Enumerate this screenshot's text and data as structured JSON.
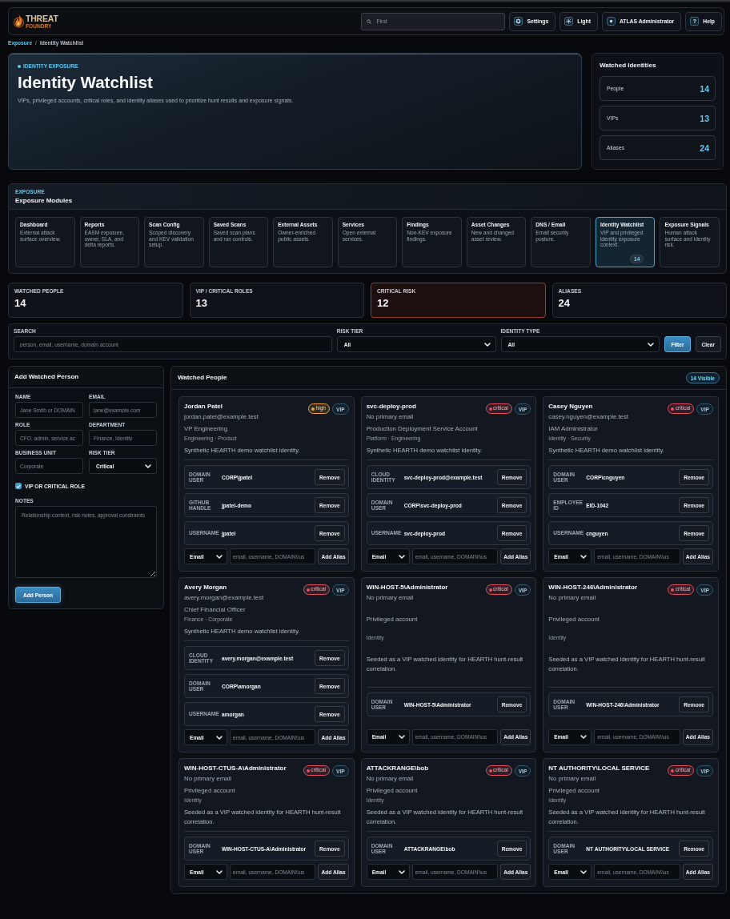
{
  "header": {
    "logo": {
      "wordmark": "THREAT",
      "subtitle": "FOUNDRY"
    },
    "search": {
      "placeholder": "Find"
    },
    "buttons": [
      {
        "kind": "gear",
        "label": "Settings"
      },
      {
        "kind": "sun",
        "label": "Light"
      },
      {
        "kind": "dot",
        "label": "ATLAS Administrator"
      },
      {
        "kind": "glyph",
        "glyph": "?",
        "label": "Help"
      }
    ]
  },
  "breadcrumb": {
    "separator": "/",
    "items": [
      {
        "label": "Exposure",
        "current": false
      },
      {
        "label": "Identity Watchlist",
        "current": true
      }
    ]
  },
  "hero": {
    "eyebrow": "IDENTITY EXPOSURE",
    "title": "Identity Watchlist",
    "description": "VIPs, privileged accounts, critical roles, and identity aliases used to prioritize hunt results and exposure signals."
  },
  "summary": {
    "title": "Watched Identities",
    "items": [
      {
        "label": "People",
        "value": "14"
      },
      {
        "label": "VIPs",
        "value": "13"
      },
      {
        "label": "Aliases",
        "value": "24"
      }
    ]
  },
  "modules": {
    "eyebrow": "EXPOSURE",
    "title": "Exposure Modules",
    "items": [
      {
        "name": "Dashboard",
        "description": "External attack surface overview.",
        "selected": false
      },
      {
        "name": "Reports",
        "description": "EASM exposure, owner, SLA, and delta reports.",
        "selected": false
      },
      {
        "name": "Scan Config",
        "description": "Scoped discovery and KEV validation setup.",
        "selected": false
      },
      {
        "name": "Saved Scans",
        "description": "Saved scan plans and run controls.",
        "selected": false
      },
      {
        "name": "External Assets",
        "description": "Owner-enriched public assets.",
        "selected": false
      },
      {
        "name": "Services",
        "description": "Open external services.",
        "selected": false
      },
      {
        "name": "Findings",
        "description": "Non-KEV exposure findings.",
        "selected": false
      },
      {
        "name": "Asset Changes",
        "description": "New and changed asset review.",
        "selected": false
      },
      {
        "name": "DNS / Email",
        "description": "Email security posture.",
        "selected": false
      },
      {
        "name": "Identity Watchlist",
        "description": "VIP and privileged identity exposure context.",
        "selected": true,
        "count": "14"
      },
      {
        "name": "Exposure Signals",
        "description": "Human attack surface and identity risk.",
        "selected": false
      }
    ]
  },
  "stats": [
    {
      "label": "WATCHED PEOPLE",
      "value": "14",
      "alert": false
    },
    {
      "label": "VIP / CRITICAL ROLES",
      "value": "13",
      "alert": false
    },
    {
      "label": "CRITICAL RISK",
      "value": "12",
      "alert": true
    },
    {
      "label": "ALIASES",
      "value": "24",
      "alert": false
    }
  ],
  "filters": {
    "fields": [
      {
        "kind": "input",
        "label": "SEARCH",
        "placeholder": "person, email, username, domain account"
      },
      {
        "kind": "select",
        "label": "RISK TIER",
        "value": "All"
      },
      {
        "kind": "select",
        "label": "IDENTITY TYPE",
        "value": "All"
      }
    ],
    "buttons": [
      {
        "label": "Filter",
        "primary": true
      },
      {
        "label": "Clear",
        "primary": false
      }
    ]
  },
  "add_form": {
    "title": "Add Watched Person",
    "fields": [
      {
        "kind": "input",
        "label": "NAME",
        "placeholder": "Jane Smith or DOMAIN"
      },
      {
        "kind": "input",
        "label": "EMAIL",
        "placeholder": "jane@example.com"
      },
      {
        "kind": "input",
        "label": "ROLE",
        "placeholder": "CFO, admin, service ac"
      },
      {
        "kind": "input",
        "label": "DEPARTMENT",
        "placeholder": "Finance, Identity"
      },
      {
        "kind": "input",
        "label": "BUSINESS UNIT",
        "placeholder": "Corporate"
      },
      {
        "kind": "select",
        "label": "RISK TIER",
        "value": "Critical"
      }
    ],
    "vip": {
      "label": "VIP OR CRITICAL ROLE",
      "checked": true
    },
    "notes": {
      "label": "NOTES",
      "placeholder": "Relationship context, risk notes, approval constraints"
    },
    "submit": "Add Person"
  },
  "people_panel": {
    "title": "Watched People",
    "badge": "14 Visible",
    "people": [
      {
        "name": "Jordan Patel",
        "email": "jordan.patel@example.test",
        "risk": {
          "label": "high",
          "color": "#f0a53a"
        },
        "tag": "VIP",
        "role": "VP Engineering",
        "org": "Engineering · Product",
        "note": "Synthetic HEARTH demo watchlist identity.",
        "aliases": [
          {
            "type": "DOMAIN USER",
            "value": "CORP\\jpatel",
            "action": "Remove"
          },
          {
            "type": "GITHUB HANDLE",
            "value": "jpatel-demo",
            "action": "Remove"
          },
          {
            "type": "USERNAME",
            "value": "jpatel",
            "action": "Remove"
          }
        ],
        "add_alias": {
          "type": "Email",
          "placeholder": "email, username, DOMAIN\\\\us",
          "button": "Add Alias"
        }
      },
      {
        "name": "svc-deploy-prod",
        "email": "No primary email",
        "risk": {
          "label": "critical",
          "color": "#e5505e"
        },
        "tag": "VIP",
        "role": "Production Deployment Service Account",
        "org": "Platform · Engineering",
        "note": "Synthetic HEARTH demo watchlist identity.",
        "aliases": [
          {
            "type": "CLOUD IDENTITY",
            "value": "svc-deploy-prod@example.test",
            "action": "Remove"
          },
          {
            "type": "DOMAIN USER",
            "value": "CORP\\svc-deploy-prod",
            "action": "Remove"
          },
          {
            "type": "USERNAME",
            "value": "svc-deploy-prod",
            "action": "Remove"
          }
        ],
        "add_alias": {
          "type": "Email",
          "placeholder": "email, username, DOMAIN\\\\us",
          "button": "Add Alias"
        }
      },
      {
        "name": "Casey Nguyen",
        "email": "casey.nguyen@example.test",
        "risk": {
          "label": "critical",
          "color": "#e5505e"
        },
        "tag": "VIP",
        "role": "IAM Administrator",
        "org": "Identity · Security",
        "note": "Synthetic HEARTH demo watchlist identity.",
        "aliases": [
          {
            "type": "DOMAIN USER",
            "value": "CORP\\cnguyen",
            "action": "Remove"
          },
          {
            "type": "EMPLOYEE ID",
            "value": "EID-1042",
            "action": "Remove"
          },
          {
            "type": "USERNAME",
            "value": "cnguyen",
            "action": "Remove"
          }
        ],
        "add_alias": {
          "type": "Email",
          "placeholder": "email, username, DOMAIN\\\\us",
          "button": "Add Alias"
        }
      },
      {
        "name": "Avery Morgan",
        "email": "avery.morgan@example.test",
        "risk": {
          "label": "critical",
          "color": "#e5505e"
        },
        "tag": "VIP",
        "role": "Chief Financial Officer",
        "org": "Finance · Corporate",
        "note": "Synthetic HEARTH demo watchlist identity.",
        "aliases": [
          {
            "type": "CLOUD IDENTITY",
            "value": "avery.morgan@example.test",
            "action": "Remove"
          },
          {
            "type": "DOMAIN USER",
            "value": "CORP\\amorgan",
            "action": "Remove"
          },
          {
            "type": "USERNAME",
            "value": "amorgan",
            "action": "Remove"
          }
        ],
        "add_alias": {
          "type": "Email",
          "placeholder": "email, username, DOMAIN\\\\us",
          "button": "Add Alias"
        }
      },
      {
        "name": "WIN-HOST-5\\Administrator",
        "email": "No primary email",
        "risk": {
          "label": "critical",
          "color": "#e5505e"
        },
        "tag": "VIP",
        "role": "Privileged account",
        "org": "Identity",
        "note": "Seeded as a VIP watched identity for HEARTH hunt-result correlation.",
        "aliases": [
          {
            "type": "DOMAIN USER",
            "value": "WIN-HOST-5\\Administrator",
            "action": "Remove"
          }
        ],
        "add_alias": {
          "type": "Email",
          "placeholder": "email, username, DOMAIN\\\\us",
          "button": "Add Alias"
        }
      },
      {
        "name": "WIN-HOST-246\\Administrator",
        "email": "No primary email",
        "risk": {
          "label": "critical",
          "color": "#e5505e"
        },
        "tag": "VIP",
        "role": "Privileged account",
        "org": "Identity",
        "note": "Seeded as a VIP watched identity for HEARTH hunt-result correlation.",
        "aliases": [
          {
            "type": "DOMAIN USER",
            "value": "WIN-HOST-246\\Administrator",
            "action": "Remove"
          }
        ],
        "add_alias": {
          "type": "Email",
          "placeholder": "email, username, DOMAIN\\\\us",
          "button": "Add Alias"
        }
      },
      {
        "name": "WIN-HOST-CTUS-A\\Administrator",
        "email": "No primary email",
        "risk": {
          "label": "critical",
          "color": "#e5505e"
        },
        "tag": "VIP",
        "role": "Privileged account",
        "org": "Identity",
        "note": "Seeded as a VIP watched identity for HEARTH hunt-result correlation.",
        "aliases": [
          {
            "type": "DOMAIN USER",
            "value": "WIN-HOST-CTUS-A\\Administrator",
            "action": "Remove"
          }
        ],
        "add_alias": {
          "type": "Email",
          "placeholder": "email, username, DOMAIN\\\\us",
          "button": "Add Alias"
        }
      },
      {
        "name": "ATTACKRANGE\\bob",
        "email": "No primary email",
        "risk": {
          "label": "critical",
          "color": "#e5505e"
        },
        "tag": "VIP",
        "role": "Privileged account",
        "org": "Identity",
        "note": "Seeded as a VIP watched identity for HEARTH hunt-result correlation.",
        "aliases": [
          {
            "type": "DOMAIN USER",
            "value": "ATTACKRANGE\\bob",
            "action": "Remove"
          }
        ],
        "add_alias": {
          "type": "Email",
          "placeholder": "email, username, DOMAIN\\\\us",
          "button": "Add Alias"
        }
      },
      {
        "name": "NT AUTHORITY\\LOCAL SERVICE",
        "email": "No primary email",
        "risk": {
          "label": "critical",
          "color": "#e5505e"
        },
        "tag": "VIP",
        "role": "Privileged account",
        "org": "Identity",
        "note": "Seeded as a VIP watched identity for HEARTH hunt-result correlation.",
        "aliases": [
          {
            "type": "DOMAIN USER",
            "value": "NT AUTHORITY\\LOCAL SERVICE",
            "action": "Remove"
          }
        ],
        "add_alias": {
          "type": "Email",
          "placeholder": "email, username, DOMAIN\\\\us",
          "button": "Add Alias"
        }
      }
    ]
  }
}
